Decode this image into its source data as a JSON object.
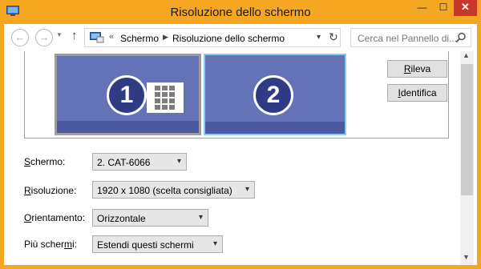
{
  "window": {
    "title": "Risoluzione dello schermo",
    "controls": {
      "minimize": "—",
      "maximize": "☐",
      "close": "✕"
    },
    "accent": "#f6a722"
  },
  "nav": {
    "back": "←",
    "forward": "→",
    "recent": "▼",
    "up": "↑",
    "address": {
      "chevron": "«",
      "crumbs": [
        "Schermo",
        "Risoluzione dello schermo"
      ],
      "separator": "▶",
      "dropdown": "▾",
      "refresh": "↻"
    },
    "search_placeholder": "Cerca nel Pannello di..."
  },
  "preview": {
    "monitors": [
      {
        "number": "1",
        "selected": true
      },
      {
        "number": "2",
        "selected": false
      }
    ],
    "dots": "●●●",
    "buttons": {
      "detect": {
        "pre": "",
        "key": "R",
        "post": "ileva"
      },
      "identify": {
        "pre": "",
        "key": "I",
        "post": "dentifica"
      }
    }
  },
  "form": {
    "screen": {
      "label_key": "S",
      "label_rest": "chermo:",
      "value": "2. CAT-6066"
    },
    "resolution": {
      "label_key": "R",
      "label_rest": "isoluzione:",
      "value": "1920 x 1080 (scelta consigliata)"
    },
    "orientation": {
      "label_key": "O",
      "label_rest": "rientamento:",
      "value": "Orizzontale"
    },
    "multiple": {
      "label_pre": "Più scher",
      "label_key": "m",
      "label_rest": "i:",
      "value": "Estendi questi schermi"
    },
    "arrow": "▾"
  },
  "scrollbar": {
    "up": "▲",
    "down": "▼"
  }
}
